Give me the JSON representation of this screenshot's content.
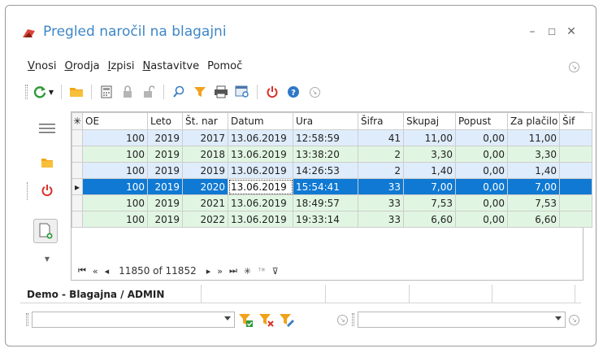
{
  "window": {
    "title": "Pregled naročil na blagajni"
  },
  "menu": [
    {
      "label": "Vnosi",
      "mnemonic": "V",
      "rest": "nosi"
    },
    {
      "label": "Orodja",
      "mnemonic": "O",
      "rest": "rodja"
    },
    {
      "label": "Izpisi",
      "mnemonic": "I",
      "rest": "zpisi"
    },
    {
      "label": "Nastavitve",
      "mnemonic": "N",
      "rest": "astavitve"
    },
    {
      "label": "Pomoč",
      "mnemonic": "",
      "rest": "Pomoč"
    }
  ],
  "toolbar_icons": [
    "refresh-icon",
    "folder-icon",
    "calculator-icon",
    "lock-icon",
    "unlock-icon",
    "search-icon",
    "filter-icon",
    "print-icon",
    "report-icon",
    "power-icon",
    "help-icon",
    "expand-icon"
  ],
  "grid": {
    "columns": [
      "OE",
      "Leto",
      "Št. nar",
      "Datum",
      "Ura",
      "Šifra",
      "Skupaj",
      "Popust",
      "Za plačilo",
      "Šif"
    ],
    "rows": [
      {
        "style": "blue",
        "cells": [
          "100",
          "2019",
          "2017",
          "13.06.2019",
          "12:58:59",
          "41",
          "11,00",
          "0,00",
          "11,00",
          ""
        ]
      },
      {
        "style": "green",
        "cells": [
          "100",
          "2019",
          "2018",
          "13.06.2019",
          "13:38:20",
          "2",
          "3,30",
          "0,00",
          "3,30",
          ""
        ]
      },
      {
        "style": "blue",
        "cells": [
          "100",
          "2019",
          "2019",
          "13.06.2019",
          "14:26:53",
          "2",
          "1,40",
          "0,00",
          "1,40",
          ""
        ]
      },
      {
        "style": "selected",
        "cells": [
          "100",
          "2019",
          "2020",
          "13.06.2019",
          "15:54:41",
          "33",
          "7,00",
          "0,00",
          "7,00",
          ""
        ]
      },
      {
        "style": "green",
        "cells": [
          "100",
          "2019",
          "2021",
          "13.06.2019",
          "18:49:57",
          "33",
          "7,53",
          "0,00",
          "7,53",
          ""
        ]
      },
      {
        "style": "green",
        "cells": [
          "100",
          "2019",
          "2022",
          "13.06.2019",
          "19:33:14",
          "33",
          "6,60",
          "0,00",
          "6,60",
          ""
        ]
      }
    ],
    "navigator": {
      "position": "11850 of 11852"
    }
  },
  "status": {
    "label": "Demo - Blagajna / ADMIN"
  },
  "colors": {
    "accent": "#3d86c6",
    "selected_row": "#0f79d3",
    "blue_row": "#dfecfb",
    "green_row": "#e1f6e2"
  }
}
